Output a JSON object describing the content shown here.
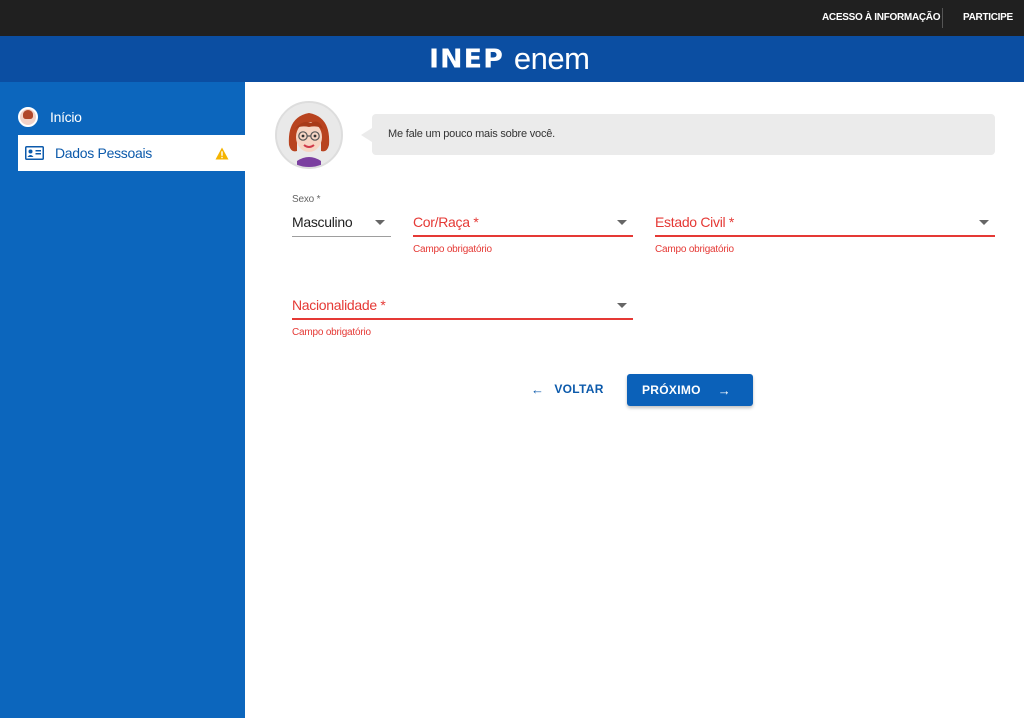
{
  "gov_bar": {
    "access_info": "ACESSO À INFORMAÇÃO",
    "participate": "PARTICIPE"
  },
  "brand": {
    "inep": "INEP",
    "enem": "enem"
  },
  "sidebar": {
    "items": [
      {
        "label": "Início",
        "icon": "avatar-icon",
        "active": false
      },
      {
        "label": "Dados Pessoais",
        "icon": "id-card-icon",
        "active": true,
        "status_icon": "warning-icon"
      }
    ]
  },
  "assistant": {
    "message": "Me fale um pouco mais sobre você."
  },
  "form": {
    "sexo": {
      "label": "Sexo *",
      "value": "Masculino"
    },
    "cor_raca": {
      "label": "Cor/Raça *",
      "error": "Campo obrigatório"
    },
    "estado_civil": {
      "label": "Estado Civil *",
      "error": "Campo obrigatório"
    },
    "nacionalidade": {
      "label": "Nacionalidade *",
      "error": "Campo obrigatório"
    }
  },
  "actions": {
    "back_label": "VOLTAR",
    "next_label": "PRÓXIMO",
    "back_icon": "arrow-left-icon",
    "next_icon": "arrow-right-icon"
  },
  "colors": {
    "gov_bar": "#202020",
    "brand_bar": "#0b4ea2",
    "sidebar": "#0c66bd",
    "primary_button": "#0b61b9",
    "error": "#e53935",
    "warning": "#f5b400"
  }
}
